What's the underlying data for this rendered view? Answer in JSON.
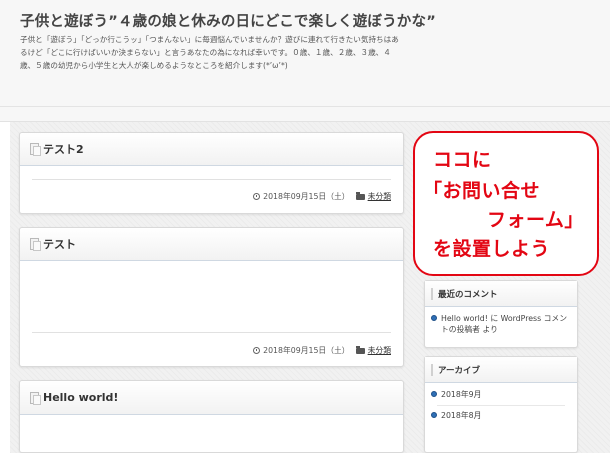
{
  "header": {
    "site_title": "子供と遊ぼう”４歳の娘と休みの日にどこで楽しく遊ぼうかな”",
    "description": "子供と「遊ぼう」「どっか行こうッ」「つまんない」に毎週悩んでいませんか？遊びに連れて行きたい気持ちはあるけど「どこに行けばいいか決まらない」と言うあなたの為になれば幸いです。０歳、１歳、２歳、３歳、４歳、５歳の幼児から小学生と大人が楽しめるようなところを紹介します(*’ω’*)"
  },
  "posts": [
    {
      "title": "テスト2",
      "date": "2018年09月15日（土）",
      "category": "未分類"
    },
    {
      "title": "テスト",
      "date": "2018年09月15日（土）",
      "category": "未分類"
    },
    {
      "title": "Hello world!"
    }
  ],
  "callout": {
    "line1": "ココに",
    "line2": "「お問い合せ",
    "line3": "フォーム」",
    "line4": "を設置しよう",
    "color": "#e30613"
  },
  "sidebar": {
    "recent_comments": {
      "title": "最近のコメント",
      "items": [
        "Hello world! に WordPress コメントの投稿者 より"
      ]
    },
    "archives": {
      "title": "アーカイブ",
      "items": [
        "2018年9月",
        "2018年8月"
      ]
    }
  }
}
